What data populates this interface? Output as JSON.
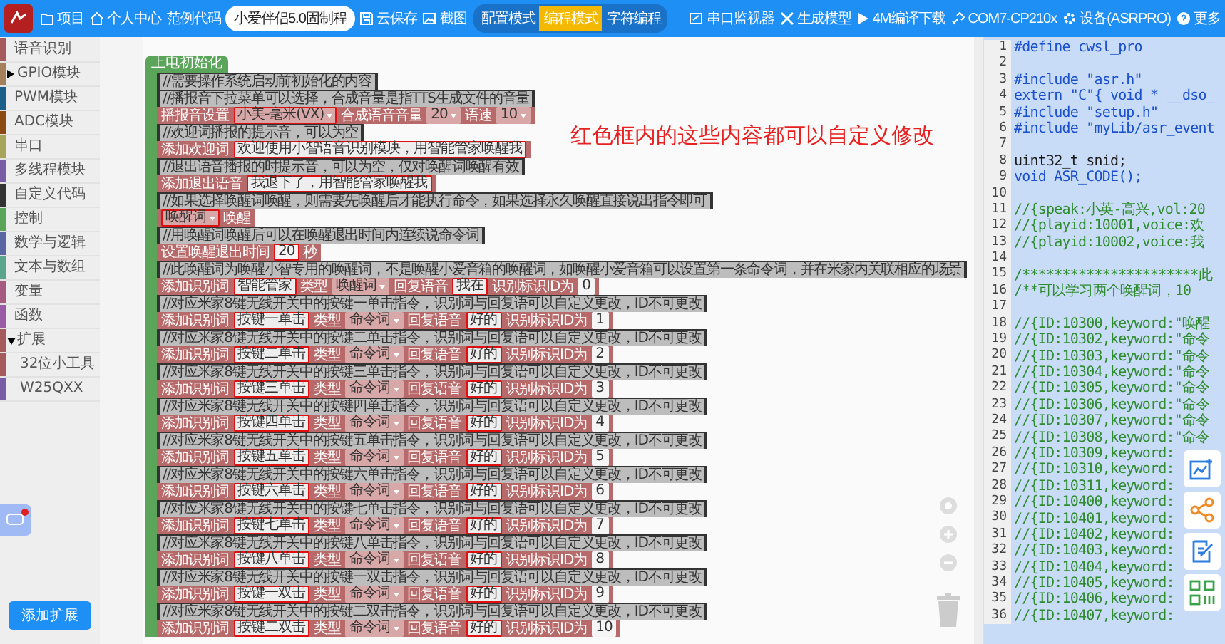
{
  "topbar": {
    "nav": [
      {
        "label": "项目"
      },
      {
        "label": "个人中心"
      },
      {
        "label": "范例代码"
      }
    ],
    "project_name": "小爱伴侣5.0固制程",
    "actions": [
      {
        "label": "云保存"
      },
      {
        "label": "截图"
      }
    ],
    "modes": [
      {
        "label": "配置模式",
        "selected": false
      },
      {
        "label": "编程模式",
        "selected": true
      },
      {
        "label": "字符编程",
        "selected": false
      }
    ],
    "tools": [
      {
        "label": "串口监视器"
      },
      {
        "label": "生成模型"
      },
      {
        "label": "4M编译下载"
      },
      {
        "label": "COM7-CP210x"
      },
      {
        "label": "设备(ASRPRO)"
      },
      {
        "label": "更多"
      }
    ]
  },
  "sidebar": {
    "categories": [
      {
        "label": "语音识别",
        "color": "#a55b5b"
      },
      {
        "label": "GPIO模块",
        "color": "#a5805b",
        "expanded": false
      },
      {
        "label": "PWM模块",
        "color": "#1c5f8a"
      },
      {
        "label": "ADC模块",
        "color": "#8a4a10"
      },
      {
        "label": "串口",
        "color": "#a5a55b"
      },
      {
        "label": "多线程模块",
        "color": "#7a5ba5"
      },
      {
        "label": "自定义代码",
        "color": "#333333"
      },
      {
        "label": "控制",
        "color": "#5ba55b"
      },
      {
        "label": "数学与逻辑",
        "color": "#5b67a5"
      },
      {
        "label": "文本与数组",
        "color": "#5ba58c"
      },
      {
        "label": "变量",
        "color": "#a55b80"
      },
      {
        "label": "函数",
        "color": "#995ba5"
      },
      {
        "label": "扩展",
        "color": "#a55b5b",
        "expanded": true,
        "children": [
          {
            "label": "32位小工具",
            "color": "#a55b5b"
          },
          {
            "label": "W25QXX",
            "color": "#7a5ba5"
          }
        ]
      }
    ],
    "add_button": "添加扩展"
  },
  "workspace": {
    "hat": "上电初始化",
    "annotation": "红色框内的这些内容都可以自定义修改",
    "rows": [
      {
        "kind": "comment",
        "text": "//需要操作系统启动前初始化的内容"
      },
      {
        "kind": "comment",
        "text": "//播报音下拉菜单可以选择，合成音量是指TTS生成文件的音量"
      },
      {
        "kind": "statement",
        "parts": [
          {
            "kind": "label",
            "text": "播报音设置"
          },
          {
            "kind": "dropdown",
            "value": "小美-毫米(VX)",
            "highlighted": true
          },
          {
            "kind": "label",
            "text": "合成语音音量"
          },
          {
            "kind": "dropdown",
            "value": "20",
            "highlighted": false
          },
          {
            "kind": "label",
            "text": "语速"
          },
          {
            "kind": "dropdown",
            "value": "10",
            "highlighted": false
          }
        ]
      },
      {
        "kind": "comment",
        "text": "//欢迎词播报的提示音，可以为空"
      },
      {
        "kind": "statement",
        "parts": [
          {
            "kind": "label",
            "text": "添加欢迎词"
          },
          {
            "kind": "input",
            "value": "欢迎使用小智语音识别模块，用智能管家唤醒我",
            "highlighted": true
          }
        ]
      },
      {
        "kind": "comment",
        "text": "//退出语音播报的时提示音，可以为空，仅对唤醒词唤醒有效"
      },
      {
        "kind": "statement",
        "parts": [
          {
            "kind": "label",
            "text": "添加退出语音"
          },
          {
            "kind": "input",
            "value": "我退下了，用智能管家唤醒我",
            "highlighted": true
          }
        ]
      },
      {
        "kind": "comment",
        "text": "//如果选择唤醒词唤醒，则需要先唤醒后才能执行命令，如果选择永久唤醒直接说出指令即可"
      },
      {
        "kind": "statement",
        "parts": [
          {
            "kind": "dropdown",
            "value": "唤醒词",
            "highlighted": true
          },
          {
            "kind": "label",
            "text": "唤醒"
          }
        ]
      },
      {
        "kind": "comment",
        "text": "//用唤醒词唤醒后可以在唤醒退出时间内连续说命令词"
      },
      {
        "kind": "statement",
        "parts": [
          {
            "kind": "label",
            "text": "设置唤醒退出时间"
          },
          {
            "kind": "number",
            "value": "20",
            "highlighted": true
          },
          {
            "kind": "label",
            "text": "秒"
          }
        ]
      },
      {
        "kind": "comment",
        "text": "//此唤醒词为唤醒小智专用的唤醒词，不是唤醒小爱音箱的唤醒词，如唤醒小爱音箱可以设置第一条命令词，并在米家内关联相应的场景"
      },
      {
        "kind": "statement",
        "parts": [
          {
            "kind": "label",
            "text": "添加识别词"
          },
          {
            "kind": "input",
            "value": "智能管家",
            "highlighted": true
          },
          {
            "kind": "label",
            "text": "类型"
          },
          {
            "kind": "dropdown",
            "value": "唤醒词",
            "highlighted": false
          },
          {
            "kind": "label",
            "text": "回复语音"
          },
          {
            "kind": "input",
            "value": "我在",
            "highlighted": true
          },
          {
            "kind": "label",
            "text": "识别标识ID为"
          },
          {
            "kind": "number",
            "value": "0",
            "highlighted": false
          }
        ]
      },
      {
        "kind": "comment",
        "text": "//对应米家8键无线开关中的按键一单击指令，识别词与回复语可以自定义更改，ID不可更改"
      },
      {
        "kind": "statement",
        "parts": [
          {
            "kind": "label",
            "text": "添加识别词"
          },
          {
            "kind": "input",
            "value": "按键一单击",
            "highlighted": true
          },
          {
            "kind": "label",
            "text": "类型"
          },
          {
            "kind": "dropdown",
            "value": "命令词",
            "highlighted": false
          },
          {
            "kind": "label",
            "text": "回复语音"
          },
          {
            "kind": "input",
            "value": "好的",
            "highlighted": true
          },
          {
            "kind": "label",
            "text": "识别标识ID为"
          },
          {
            "kind": "number",
            "value": "1",
            "highlighted": false
          }
        ]
      },
      {
        "kind": "comment",
        "text": "//对应米家8键无线开关中的按键二单击指令，识别词与回复语可以自定义更改，ID不可更改"
      },
      {
        "kind": "statement",
        "parts": [
          {
            "kind": "label",
            "text": "添加识别词"
          },
          {
            "kind": "input",
            "value": "按键二单击",
            "highlighted": true
          },
          {
            "kind": "label",
            "text": "类型"
          },
          {
            "kind": "dropdown",
            "value": "命令词",
            "highlighted": false
          },
          {
            "kind": "label",
            "text": "回复语音"
          },
          {
            "kind": "input",
            "value": "好的",
            "highlighted": true
          },
          {
            "kind": "label",
            "text": "识别标识ID为"
          },
          {
            "kind": "number",
            "value": "2",
            "highlighted": false
          }
        ]
      },
      {
        "kind": "comment",
        "text": "//对应米家8键无线开关中的按键三单击指令，识别词与回复语可以自定义更改，ID不可更改"
      },
      {
        "kind": "statement",
        "parts": [
          {
            "kind": "label",
            "text": "添加识别词"
          },
          {
            "kind": "input",
            "value": "按键三单击",
            "highlighted": true
          },
          {
            "kind": "label",
            "text": "类型"
          },
          {
            "kind": "dropdown",
            "value": "命令词",
            "highlighted": false
          },
          {
            "kind": "label",
            "text": "回复语音"
          },
          {
            "kind": "input",
            "value": "好的",
            "highlighted": true
          },
          {
            "kind": "label",
            "text": "识别标识ID为"
          },
          {
            "kind": "number",
            "value": "3",
            "highlighted": false
          }
        ]
      },
      {
        "kind": "comment",
        "text": "//对应米家8键无线开关中的按键四单击指令，识别词与回复语可以自定义更改，ID不可更改"
      },
      {
        "kind": "statement",
        "parts": [
          {
            "kind": "label",
            "text": "添加识别词"
          },
          {
            "kind": "input",
            "value": "按键四单击",
            "highlighted": true
          },
          {
            "kind": "label",
            "text": "类型"
          },
          {
            "kind": "dropdown",
            "value": "命令词",
            "highlighted": false
          },
          {
            "kind": "label",
            "text": "回复语音"
          },
          {
            "kind": "input",
            "value": "好的",
            "highlighted": true
          },
          {
            "kind": "label",
            "text": "识别标识ID为"
          },
          {
            "kind": "number",
            "value": "4",
            "highlighted": false
          }
        ]
      },
      {
        "kind": "comment",
        "text": "//对应米家8键无线开关中的按键五单击指令，识别词与回复语可以自定义更改，ID不可更改"
      },
      {
        "kind": "statement",
        "parts": [
          {
            "kind": "label",
            "text": "添加识别词"
          },
          {
            "kind": "input",
            "value": "按键五单击",
            "highlighted": true
          },
          {
            "kind": "label",
            "text": "类型"
          },
          {
            "kind": "dropdown",
            "value": "命令词",
            "highlighted": false
          },
          {
            "kind": "label",
            "text": "回复语音"
          },
          {
            "kind": "input",
            "value": "好的",
            "highlighted": true
          },
          {
            "kind": "label",
            "text": "识别标识ID为"
          },
          {
            "kind": "number",
            "value": "5",
            "highlighted": false
          }
        ]
      },
      {
        "kind": "comment",
        "text": "//对应米家8键无线开关中的按键六单击指令，识别词与回复语可以自定义更改，ID不可更改"
      },
      {
        "kind": "statement",
        "parts": [
          {
            "kind": "label",
            "text": "添加识别词"
          },
          {
            "kind": "input",
            "value": "按键六单击",
            "highlighted": true
          },
          {
            "kind": "label",
            "text": "类型"
          },
          {
            "kind": "dropdown",
            "value": "命令词",
            "highlighted": false
          },
          {
            "kind": "label",
            "text": "回复语音"
          },
          {
            "kind": "input",
            "value": "好的",
            "highlighted": true
          },
          {
            "kind": "label",
            "text": "识别标识ID为"
          },
          {
            "kind": "number",
            "value": "6",
            "highlighted": false
          }
        ]
      },
      {
        "kind": "comment",
        "text": "//对应米家8键无线开关中的按键七单击指令，识别词与回复语可以自定义更改，ID不可更改"
      },
      {
        "kind": "statement",
        "parts": [
          {
            "kind": "label",
            "text": "添加识别词"
          },
          {
            "kind": "input",
            "value": "按键七单击",
            "highlighted": true
          },
          {
            "kind": "label",
            "text": "类型"
          },
          {
            "kind": "dropdown",
            "value": "命令词",
            "highlighted": false
          },
          {
            "kind": "label",
            "text": "回复语音"
          },
          {
            "kind": "input",
            "value": "好的",
            "highlighted": true
          },
          {
            "kind": "label",
            "text": "识别标识ID为"
          },
          {
            "kind": "number",
            "value": "7",
            "highlighted": false
          }
        ]
      },
      {
        "kind": "comment",
        "text": "//对应米家8键无线开关中的按键八单击指令，识别词与回复语可以自定义更改，ID不可更改"
      },
      {
        "kind": "statement",
        "parts": [
          {
            "kind": "label",
            "text": "添加识别词"
          },
          {
            "kind": "input",
            "value": "按键八单击",
            "highlighted": true
          },
          {
            "kind": "label",
            "text": "类型"
          },
          {
            "kind": "dropdown",
            "value": "命令词",
            "highlighted": false
          },
          {
            "kind": "label",
            "text": "回复语音"
          },
          {
            "kind": "input",
            "value": "好的",
            "highlighted": true
          },
          {
            "kind": "label",
            "text": "识别标识ID为"
          },
          {
            "kind": "number",
            "value": "8",
            "highlighted": false
          }
        ]
      },
      {
        "kind": "comment",
        "text": "//对应米家8键无线开关中的按键一双击指令，识别词与回复语可以自定义更改，ID不可更改"
      },
      {
        "kind": "statement",
        "parts": [
          {
            "kind": "label",
            "text": "添加识别词"
          },
          {
            "kind": "input",
            "value": "按键一双击",
            "highlighted": true
          },
          {
            "kind": "label",
            "text": "类型"
          },
          {
            "kind": "dropdown",
            "value": "命令词",
            "highlighted": false
          },
          {
            "kind": "label",
            "text": "回复语音"
          },
          {
            "kind": "input",
            "value": "好的",
            "highlighted": true
          },
          {
            "kind": "label",
            "text": "识别标识ID为"
          },
          {
            "kind": "number",
            "value": "9",
            "highlighted": false
          }
        ]
      },
      {
        "kind": "comment",
        "text": "//对应米家8键无线开关中的按键二双击指令，识别词与回复语可以自定义更改，ID不可更改"
      },
      {
        "kind": "statement",
        "parts": [
          {
            "kind": "label",
            "text": "添加识别词"
          },
          {
            "kind": "input",
            "value": "按键二双击",
            "highlighted": true
          },
          {
            "kind": "label",
            "text": "类型"
          },
          {
            "kind": "dropdown",
            "value": "命令词",
            "highlighted": false
          },
          {
            "kind": "label",
            "text": "回复语音"
          },
          {
            "kind": "input",
            "value": "好的",
            "highlighted": true
          },
          {
            "kind": "label",
            "text": "识别标识ID为"
          },
          {
            "kind": "number",
            "value": "10",
            "highlighted": false
          }
        ]
      }
    ]
  },
  "code": {
    "lines": [
      {
        "n": "1",
        "kind": "directive",
        "text": "#define cwsl_pro"
      },
      {
        "n": "2"
      },
      {
        "n": "3",
        "kind": "directive",
        "text": "#include \"asr.h\""
      },
      {
        "n": "4",
        "kind": "directive",
        "text": "extern \"C\"{ void * __dso_"
      },
      {
        "n": "5",
        "kind": "directive",
        "text": "#include \"setup.h\""
      },
      {
        "n": "6",
        "kind": "directive",
        "text": "#include \"myLib/asr_event"
      },
      {
        "n": "7"
      },
      {
        "n": "8",
        "kind": "plain",
        "text": "uint32_t snid;"
      },
      {
        "n": "9",
        "kind": "directive",
        "text": "void ASR_CODE();"
      },
      {
        "n": "10"
      },
      {
        "n": "11",
        "kind": "comment",
        "text": "//{speak:小英-高兴,vol:20"
      },
      {
        "n": "12",
        "kind": "comment",
        "text": "//{playid:10001,voice:欢"
      },
      {
        "n": "13",
        "kind": "comment",
        "text": "//{playid:10002,voice:我"
      },
      {
        "n": "14"
      },
      {
        "n": "15",
        "kind": "comment",
        "text": "/**********************此"
      },
      {
        "n": "16",
        "kind": "comment",
        "text": "/**可以学习两个唤醒词，10"
      },
      {
        "n": "17"
      },
      {
        "n": "18",
        "kind": "comment",
        "text": "//{ID:10300,keyword:\"唤醒"
      },
      {
        "n": "19",
        "kind": "comment",
        "text": "//{ID:10302,keyword:\"命令"
      },
      {
        "n": "20",
        "kind": "comment",
        "text": "//{ID:10303,keyword:\"命令"
      },
      {
        "n": "21",
        "kind": "comment",
        "text": "//{ID:10304,keyword:\"命令"
      },
      {
        "n": "22",
        "kind": "comment",
        "text": "//{ID:10305,keyword:\"命令"
      },
      {
        "n": "23",
        "kind": "comment",
        "text": "//{ID:10306,keyword:\"命令"
      },
      {
        "n": "24",
        "kind": "comment",
        "text": "//{ID:10307,keyword:\"命令"
      },
      {
        "n": "25",
        "kind": "comment",
        "text": "//{ID:10308,keyword:\"命令"
      },
      {
        "n": "26",
        "kind": "comment",
        "text": "//{ID:10309,keyword:"
      },
      {
        "n": "27",
        "kind": "comment",
        "text": "//{ID:10310,keyword:"
      },
      {
        "n": "28",
        "kind": "comment",
        "text": "//{ID:10311,keyword:"
      },
      {
        "n": "29",
        "kind": "comment",
        "text": "//{ID:10400,keyword:"
      },
      {
        "n": "30",
        "kind": "comment",
        "text": "//{ID:10401,keyword:"
      },
      {
        "n": "31",
        "kind": "comment",
        "text": "//{ID:10402,keyword:"
      },
      {
        "n": "32",
        "kind": "comment",
        "text": "//{ID:10403,keyword:"
      },
      {
        "n": "33",
        "kind": "comment",
        "text": "//{ID:10404,keyword:"
      },
      {
        "n": "34",
        "kind": "comment",
        "text": "//{ID:10405,keyword:"
      },
      {
        "n": "35",
        "kind": "comment",
        "text": "//{ID:10406,keyword:"
      },
      {
        "n": "36",
        "kind": "comment",
        "text": "//{ID:10407,keyword:"
      }
    ]
  }
}
